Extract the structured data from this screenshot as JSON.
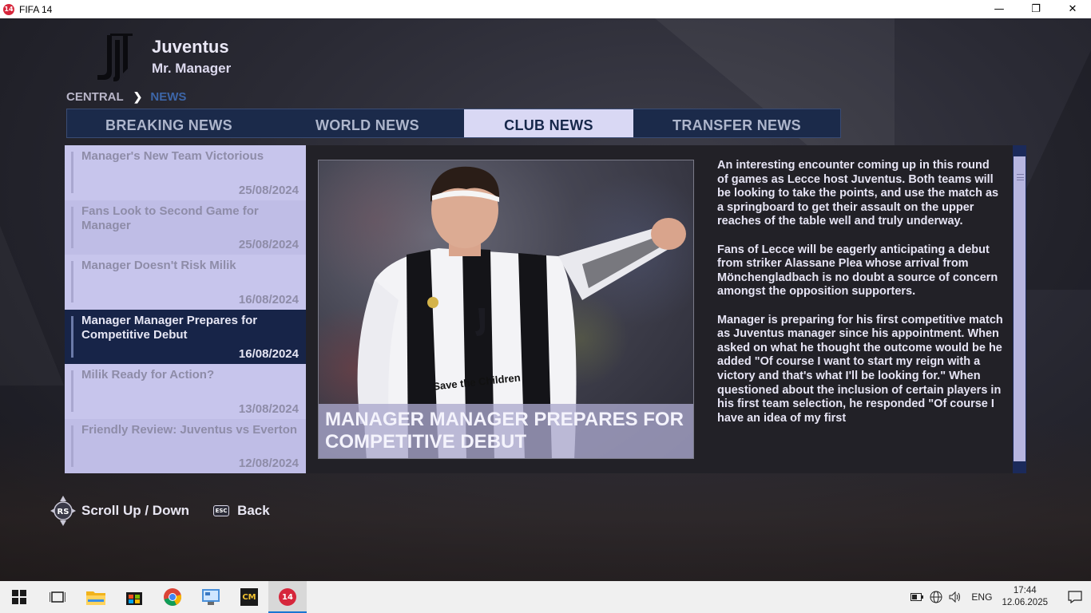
{
  "window": {
    "title": "FIFA 14",
    "app_icon_text": "14",
    "minimize_glyph": "—",
    "restore_glyph": "❐",
    "close_glyph": "✕"
  },
  "header": {
    "club_name": "Juventus",
    "manager_name": "Mr. Manager"
  },
  "breadcrumb": {
    "items": [
      "CENTRAL",
      "NEWS"
    ],
    "separator": "❯"
  },
  "tabs": [
    {
      "label": "BREAKING NEWS",
      "active": false
    },
    {
      "label": "WORLD NEWS",
      "active": false
    },
    {
      "label": "CLUB NEWS",
      "active": true
    },
    {
      "label": "TRANSFER NEWS",
      "active": false
    }
  ],
  "news_list": [
    {
      "headline": "Manager's New Team Victorious",
      "date": "25/08/2024",
      "selected": false
    },
    {
      "headline": "Fans Look to Second Game for Manager",
      "date": "25/08/2024",
      "selected": false
    },
    {
      "headline": "Manager Doesn't Risk Milik",
      "date": "16/08/2024",
      "selected": false
    },
    {
      "headline": "Manager Manager Prepares for Competitive Debut",
      "date": "16/08/2024",
      "selected": true
    },
    {
      "headline": "Milik Ready for Action?",
      "date": "13/08/2024",
      "selected": false
    },
    {
      "headline": "Friendly Review: Juventus vs Everton",
      "date": "12/08/2024",
      "selected": false
    }
  ],
  "article": {
    "caption": "MANAGER MANAGER PREPARES FOR COMPETITIVE DEBUT",
    "photo_shirt_text": "Save the Children",
    "paragraphs": [
      "An interesting encounter coming up in this round of games as Lecce host Juventus. Both teams will be looking to take the points, and use the match as a springboard to get their assault on the upper reaches of the table well and truly underway.",
      "Fans of Lecce will be eagerly anticipating a debut from striker Alassane Plea whose arrival from Mönchengladbach is no doubt a source of concern amongst the opposition supporters.",
      "Manager is preparing for his first competitive match as Juventus manager since his appointment. When asked on what he thought the outcome would be he added \"Of course I want to start my reign with a victory and that's what I'll be looking for.\" When questioned about the inclusion of certain players in his first team selection, he responded \"Of course I have an idea of my first"
    ]
  },
  "controls": {
    "scroll_label": "Scroll Up / Down",
    "back_label": "Back",
    "rs_glyph": "RS",
    "esc_glyph": "ESC"
  },
  "taskbar": {
    "language": "ENG",
    "time": "17:44",
    "date": "12.06.2025",
    "game_icon_text": "14",
    "cm_icon_text": "CM"
  },
  "colors": {
    "tab_bar_bg": "#1b2a4a",
    "tab_active_bg": "#d9d8f4",
    "list_bg": "#c7c5ec",
    "list_selected_bg": "#172448",
    "breadcrumb_active": "#3d66a8",
    "taskbar_accent": "#1976d2"
  }
}
